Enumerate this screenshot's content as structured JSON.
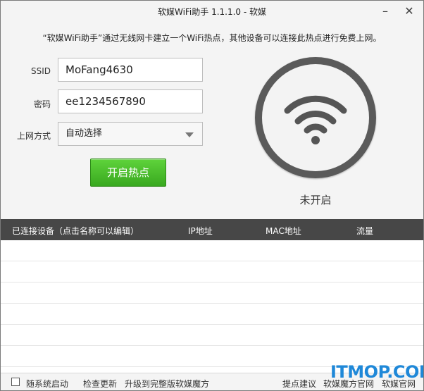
{
  "window": {
    "title": "软媒WiFi助手 1.1.1.0 - 软媒"
  },
  "intro": "“软媒WiFi助手”通过无线网卡建立一个WiFi热点，其他设备可以连接此热点进行免费上网。",
  "form": {
    "ssid_label": "SSID",
    "ssid_value": "MoFang4630",
    "password_label": "密码",
    "password_value": "ee1234567890",
    "mode_label": "上网方式",
    "mode_value": "自动选择"
  },
  "start_button": "开启热点",
  "hotspot": {
    "status": "未开启",
    "icon": "wifi-icon"
  },
  "table": {
    "columns": [
      "已连接设备（点击名称可以编辑）",
      "IP地址",
      "MAC地址",
      "流量"
    ],
    "rows": []
  },
  "footer": {
    "autostart_label": "随系统启动",
    "check_update": "检查更新",
    "upgrade": "升级到完整版软媒魔方",
    "suggestion": "提点建议",
    "ruanmei_link": "软媒魔方官网",
    "official_site": "软媒官网"
  },
  "watermark": "ITMOP.COM",
  "colors": {
    "accent_green": "#3cae22",
    "header_dark": "#474747",
    "watermark_blue": "#1f88d8"
  }
}
